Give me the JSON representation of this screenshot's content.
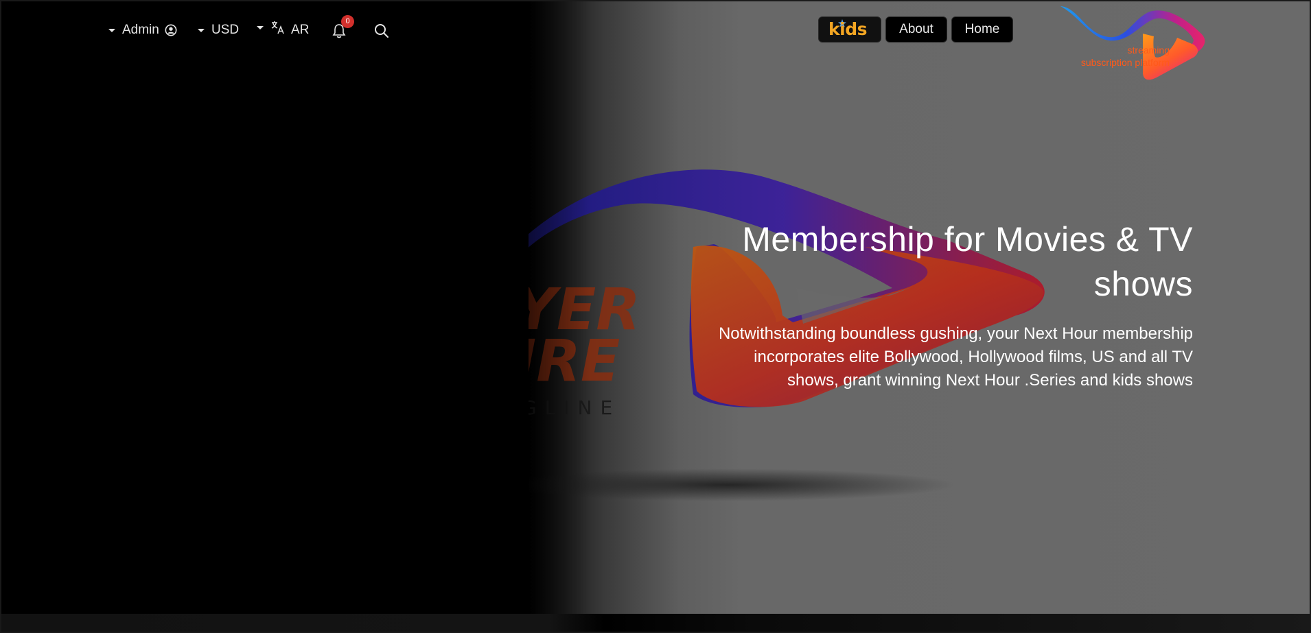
{
  "header": {
    "user_menu": {
      "label": "Admin"
    },
    "currency_menu": {
      "label": "USD"
    },
    "language_menu": {
      "label": "AR"
    },
    "notifications": {
      "count": "0"
    },
    "nav": {
      "kids_label": "kids",
      "about_label": "About",
      "home_label": "Home"
    },
    "logo": {
      "line1": "streaming",
      "line2": "subscription platform"
    }
  },
  "hero": {
    "headline": "Membership for Movies & TV shows",
    "description": "Notwithstanding boundless gushing, your Next Hour membership incorporates elite Bollywood, Hollywood films, US and all TV shows, grant winning Next Hour .Series and kids shows",
    "background_watermark_text_1": "YER",
    "background_watermark_text_2": "IRE",
    "background_watermark_text_3": "GLINE"
  },
  "colors": {
    "accent_red": "#d2302c",
    "kids_orange": "#f4a623",
    "logo_orange": "#ff5a1a"
  },
  "icons": [
    "caret-down-icon",
    "user-circle-icon",
    "translate-icon",
    "bell-icon",
    "search-icon",
    "play-logo-icon"
  ]
}
